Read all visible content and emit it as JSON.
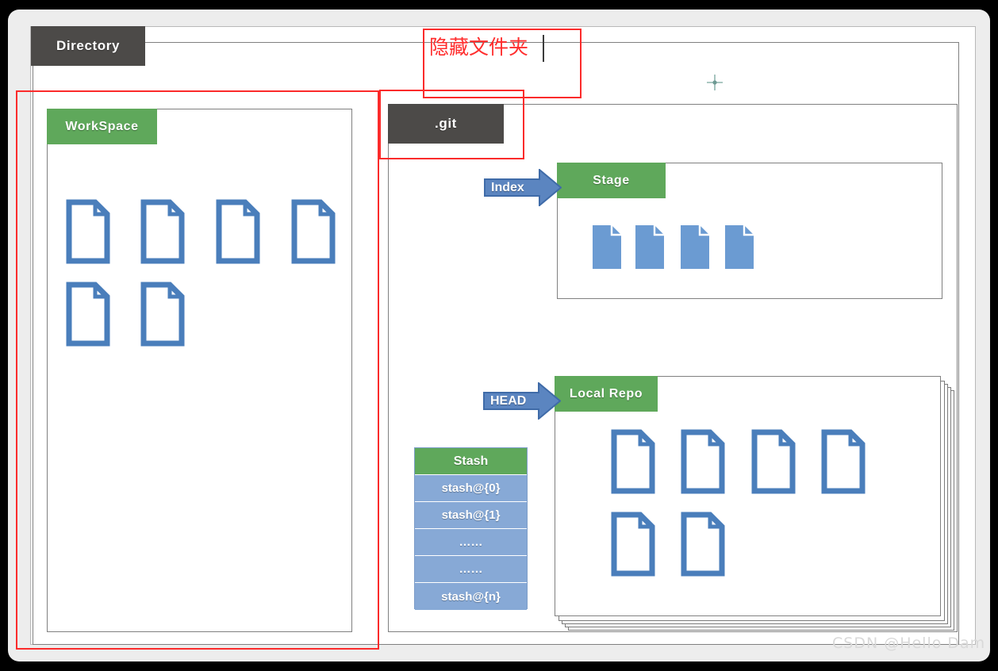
{
  "slide": {
    "title_labels": {
      "directory": "Directory",
      "git": ".git",
      "workspace": "WorkSpace",
      "stage": "Stage",
      "local_repo": "Local Repo"
    },
    "arrows": {
      "index": "Index",
      "head": "HEAD"
    },
    "annotation": {
      "text": "隐藏文件夹",
      "color": "#ff2d2d"
    },
    "stash": {
      "header": "Stash",
      "rows": [
        "stash@{0}",
        "stash@{1}",
        "……",
        "……",
        "stash@{n}"
      ]
    },
    "counts": {
      "workspace_files": 6,
      "stage_files": 4,
      "local_repo_files": 6,
      "repo_stack_cards": 4
    },
    "colors": {
      "green": "#5fa85b",
      "dark": "#4c4a48",
      "file_outline": "#4a7ebb",
      "file_fill": "#6b9bd2",
      "stash_row": "#87a9d6",
      "annotation_red": "#fb2b2b",
      "panel_border": "#808080"
    },
    "watermark": "CSDN @Hello Dam"
  }
}
